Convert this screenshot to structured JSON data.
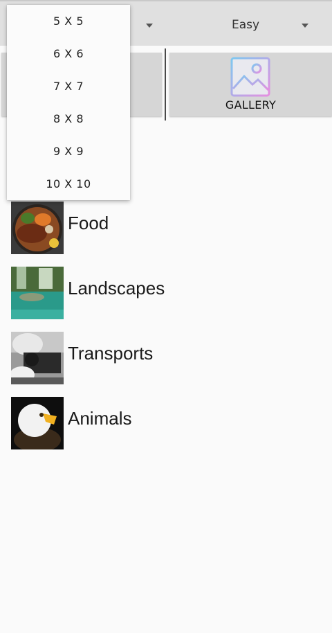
{
  "difficulty": {
    "selected": "Easy"
  },
  "gallery_button": {
    "label": "GALLERY",
    "icon": "gallery-image-icon"
  },
  "grid_size_menu": {
    "options": [
      "5 X 5",
      "6 X 6",
      "7 X 7",
      "8 X 8",
      "9 X 9",
      "10 X 10"
    ]
  },
  "categories": [
    {
      "label": "Food"
    },
    {
      "label": "Landscapes"
    },
    {
      "label": "Transports"
    },
    {
      "label": "Animals"
    }
  ],
  "colors": {
    "topbar": "#e0e0e0",
    "button_panel": "#d6d6d6",
    "gallery_icon_gradient": [
      "#7ec8f0",
      "#e58ee0"
    ]
  }
}
